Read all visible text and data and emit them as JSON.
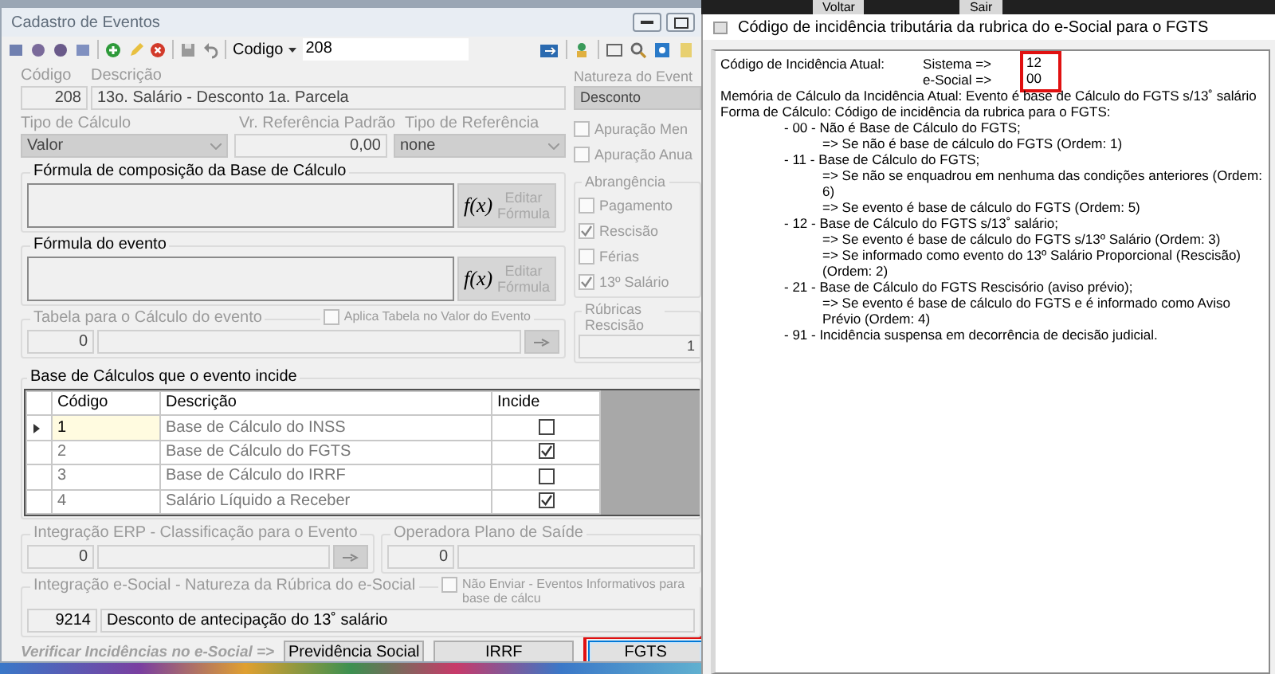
{
  "background_app": {
    "buttons": [
      "Voltar",
      "Sair"
    ]
  },
  "window": {
    "title": "Cadastro de Eventos"
  },
  "toolbar": {
    "search_field_label": "Codigo",
    "search_value": "208"
  },
  "form": {
    "codigo": {
      "label": "Código",
      "value": "208"
    },
    "descricao": {
      "label": "Descrição",
      "value": "13o. Salário - Desconto 1a. Parcela"
    },
    "natureza": {
      "label": "Natureza do Event",
      "value": "Desconto"
    },
    "tipo_calculo": {
      "label": "Tipo de Cálculo",
      "value": "Valor"
    },
    "vr_referencia": {
      "label": "Vr. Referência Padrão",
      "value": "0,00"
    },
    "tipo_referencia": {
      "label": "Tipo de Referência",
      "value": "none"
    },
    "apuracao": [
      {
        "label": "Apuração Men",
        "checked": false
      },
      {
        "label": "Apuração Anua",
        "checked": false
      }
    ],
    "formulas": [
      {
        "title": "Fórmula de composição da Base de Cálculo",
        "button_icon": "f(x)",
        "button_label": "Editar Fórmula"
      },
      {
        "title": "Fórmula do evento",
        "button_icon": "f(x)",
        "button_label": "Editar Fórmula"
      }
    ],
    "abrangencia": {
      "title": "Abrangência",
      "items": [
        {
          "label": "Pagamento",
          "checked": false
        },
        {
          "label": "Rescisão",
          "checked": true
        },
        {
          "label": "Férias",
          "checked": false
        },
        {
          "label": "13º Salário",
          "checked": true
        }
      ]
    },
    "tabela": {
      "title": "Tabela para o Cálculo do evento",
      "value": "0",
      "option": {
        "label": "Aplica Tabela no Valor do Evento",
        "checked": false
      }
    },
    "rubricas": {
      "title": "Rúbricas Rescisão",
      "value": "1"
    }
  },
  "bases": {
    "title": "Base de Cálculos que o evento incide",
    "columns": [
      "Código",
      "Descrição",
      "Incide"
    ],
    "rows": [
      {
        "codigo": "1",
        "descricao": "Base de Cálculo do INSS",
        "incide": false,
        "selected": true
      },
      {
        "codigo": "2",
        "descricao": "Base de Cálculo do FGTS",
        "incide": true,
        "selected": false
      },
      {
        "codigo": "3",
        "descricao": "Base de Cálculo do IRRF",
        "incide": false,
        "selected": false
      },
      {
        "codigo": "4",
        "descricao": "Salário Líquido a Receber",
        "incide": true,
        "selected": false
      }
    ]
  },
  "erp": {
    "title": "Integração ERP - Classificação para o Evento",
    "value": "0"
  },
  "operadora": {
    "title": "Operadora Plano de Saíde",
    "value": "0"
  },
  "esocial": {
    "title": "Integração e-Social - Natureza da Rúbrica do e-Social",
    "code": "9214",
    "description": "Desconto de antecipação do 13˚ salário",
    "option": {
      "label": "Não Enviar - Eventos Informativos para base de cálcu",
      "checked": false
    }
  },
  "footer": {
    "label": "Verificar Incidências no e-Social =>",
    "buttons": [
      {
        "label": "Previdência Social",
        "focused": false
      },
      {
        "label": "IRRF",
        "focused": false
      },
      {
        "label": "FGTS",
        "focused": true
      }
    ]
  },
  "dialog": {
    "title": "Código de incidência tributária da rubrica do e-Social para o FGTS",
    "current_label": "Código de Incidência Atual:",
    "sistema_label": "Sistema =>",
    "sistema": "12",
    "esocial_label": "e-Social =>",
    "esocial": "00",
    "memoria": "Memória de Cálculo da Incidência Atual: Evento é base de Cálculo do FGTS s/13˚ salário",
    "forma": "Forma de Cálculo: Código de incidência da rubrica para o FGTS:",
    "codes": [
      {
        "text": "- 00 - Não é Base de Cálculo do FGTS;",
        "children": [
          {
            "text": "=> Se não é base de cálculo do FGTS (Ordem: 1)"
          }
        ]
      },
      {
        "text": "- 11 - Base de Cálculo do FGTS;",
        "children": [
          {
            "text": "=> Se não se enquadrou em nenhuma das condições anteriores (Ordem: 6)"
          },
          {
            "text": "=> Se evento é base de cálculo do FGTS (Ordem: 5)"
          }
        ]
      },
      {
        "text": "- 12 - Base de Cálculo do FGTS s/13˚ salário;",
        "children": [
          {
            "text": "=> Se evento é base de cálculo do FGTS s/13º Salário (Ordem: 3)"
          },
          {
            "text": "=> Se informado como evento do 13º Salário Proporcional (Rescisão) (Ordem: 2)"
          }
        ]
      },
      {
        "text": "- 21 - Base de Cálculo do FGTS Rescisório (aviso prévio);",
        "children": [
          {
            "text": "=> Se evento é base de cálculo do FGTS e é informado como Aviso Prévio (Ordem: 4)"
          }
        ]
      },
      {
        "text": "- 91 - Incidência suspensa em decorrência de decisão judicial."
      }
    ]
  }
}
